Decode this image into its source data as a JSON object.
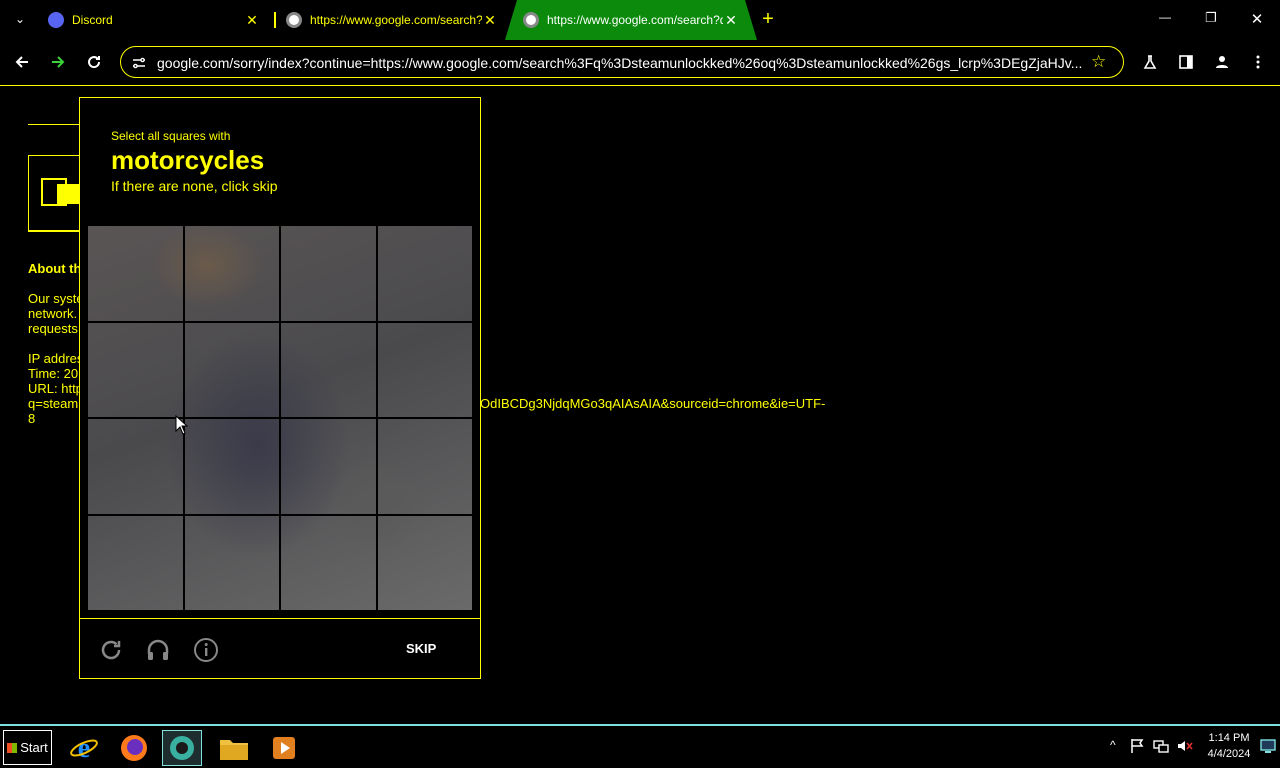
{
  "tabs": [
    {
      "title": "Discord",
      "close": "✕"
    },
    {
      "title": "https://www.google.com/search?q",
      "close": "✕"
    },
    {
      "title": "https://www.google.com/search?q",
      "close": "✕"
    }
  ],
  "new_tab": "+",
  "window_controls": {
    "minimize": "—",
    "restore": "❐",
    "close": "✕"
  },
  "toolbar": {
    "url": "google.com/sorry/index?continue=https://www.google.com/search%3Fq%3Dsteamunlockked%26oq%3Dsteamunlockked%26gs_lcrp%3DEgZjaHJv..."
  },
  "page": {
    "about_heading": "About th",
    "body_lines": [
      "Our syste",
      "network.",
      "requests"
    ],
    "ip_label": "IP addres",
    "time_label": "Time: 20",
    "url_label": "URL: http",
    "q_label": "q=steam",
    "url_tail": "OdIBCDg3NjdqMGo3qAIAsAIA&sourceid=chrome&ie=UTF-",
    "url_last": "8"
  },
  "captcha": {
    "instruction": "Select all squares with",
    "target": "motorcycles",
    "hint": "If there are none, click skip",
    "skip_label": "SKIP",
    "icons": [
      "reload-icon",
      "headphones-icon",
      "info-icon"
    ]
  },
  "taskbar": {
    "start_label": "Start",
    "clock_time": "1:14 PM",
    "clock_date": "4/4/2024"
  },
  "colors": {
    "accent": "#ffff00",
    "active_tab": "#0b8a0b",
    "taskbar_border": "#7fe0e0"
  }
}
